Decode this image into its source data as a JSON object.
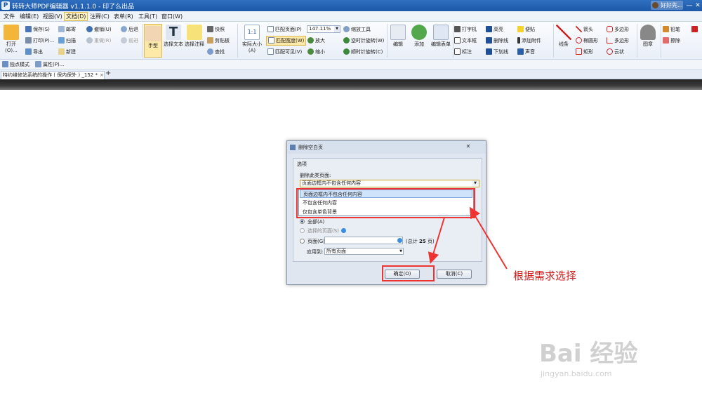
{
  "window": {
    "app_icon": "P",
    "title": "转转大师PDF编辑器 v1.1.1.0 - 印了么出品",
    "user": "好好先...",
    "controls": [
      "—",
      "□",
      "✕"
    ]
  },
  "menu": [
    "文件",
    "编辑(E)",
    "视图(V)",
    "文档(D)",
    "注释(C)",
    "表单(R)",
    "工具(T)",
    "窗口(W)"
  ],
  "ribbon": {
    "open": "打开(O)...",
    "save": "保存(S)",
    "mail": "邮寄",
    "undo": "撤销(U)",
    "back": "后退",
    "print": "打印(P)...",
    "scan": "扫描",
    "redo": "重做(R)",
    "forward": "前进",
    "export": "导出",
    "new": "新建",
    "hand": "手型",
    "select_text": "选择文本",
    "select_annot": "选择注释",
    "snapshot": "快照",
    "clipboard": "剪贴板",
    "find": "查找",
    "actual_size": "实际大小(A)",
    "fit_page": "匹配页面(P)",
    "fit_width": "匹配宽度(W)",
    "fit_visible": "匹配可见(V)",
    "zoom_value": "147.11%",
    "zoom_tool": "缩放工具",
    "zoom_in": "放大",
    "zoom_out": "缩小",
    "rotate_ccw": "逆时针旋转(W)",
    "rotate_cw": "顺时针旋转(C)",
    "edit": "编辑",
    "add": "添加",
    "edit_form": "编辑表单",
    "typewriter": "打字机",
    "textbox": "文本框",
    "callout": "标注",
    "highlight": "高亮",
    "strikeout": "删除线",
    "underline": "下划线",
    "note": "便贴",
    "attach": "添加附件",
    "sound": "声音",
    "line": "线条",
    "arrow": "箭头",
    "polygon": "多边形",
    "ellipse": "椭圆形",
    "polyline": "多边形",
    "rect": "矩形",
    "cloud": "云状",
    "stamp": "图章",
    "pencil": "铅笔",
    "eraser": "擦除"
  },
  "modebar": {
    "single_mode": "独点模式",
    "properties": "属性(P)..."
  },
  "tab": {
    "title": "特约维修站系统的操作 ( 保内保外 ) _152 *",
    "close": "×",
    "add": "+"
  },
  "dialog": {
    "title": "删除空白页",
    "close": "✕",
    "group": "选项",
    "delete_label": "删除此类页面:",
    "combo_value": "页面边框内不包含任何内容",
    "options": [
      "页面边框内不包含任何内容",
      "不包含任何内容",
      "仅包含单色背景"
    ],
    "radio_all": "全部(A)",
    "radio_selected": "选择的页面(S)",
    "radio_pages": "页面(G)",
    "total_prefix": "(总计",
    "total_value": "25",
    "total_suffix": "页)",
    "apply_label": "应用到:",
    "apply_value": "所有页面",
    "ok": "确定(O)",
    "cancel": "取消(C)"
  },
  "annotation": "根据需求选择",
  "watermark": {
    "brand": "Bai 经验",
    "url": "jingyan.baidu.com"
  },
  "colors": {
    "accent": "#1d58a8",
    "annotation_red": "#e33333"
  }
}
